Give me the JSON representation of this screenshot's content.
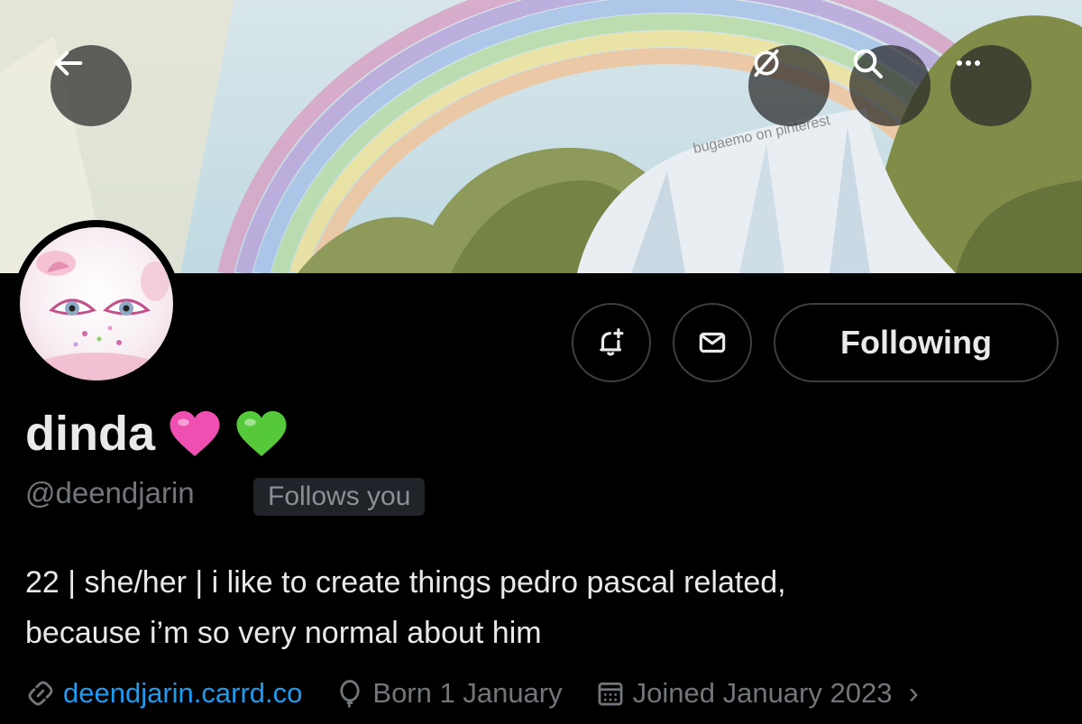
{
  "header": {
    "back_icon": "arrow-left-icon",
    "translate_icon": "slashed-globe-icon",
    "search_icon": "search-icon",
    "more_icon": "more-horizontal-icon",
    "banner_watermark": "bugaemo on pinterest"
  },
  "actions": {
    "notify_icon": "bell-plus-icon",
    "message_icon": "envelope-icon",
    "following_label": "Following"
  },
  "profile": {
    "display_name": "dinda",
    "emoji": [
      "pink-heart",
      "green-heart"
    ],
    "handle": "@deendjarin",
    "follows_you": "Follows you",
    "bio_line1": "22 | she/her | i like to create things pedro pascal related,",
    "bio_line2": "because i’m so very normal about him",
    "website": "deendjarin.carrd.co",
    "birthday": "Born 1 January",
    "joined": "Joined January 2023"
  },
  "colors": {
    "background": "#000000",
    "text_primary": "#e7e9ea",
    "text_secondary": "#71767b",
    "link": "#1d9bf0",
    "pink_heart": "#ef4fb0",
    "green_heart": "#56c93a",
    "button_border": "#3a3f44"
  }
}
